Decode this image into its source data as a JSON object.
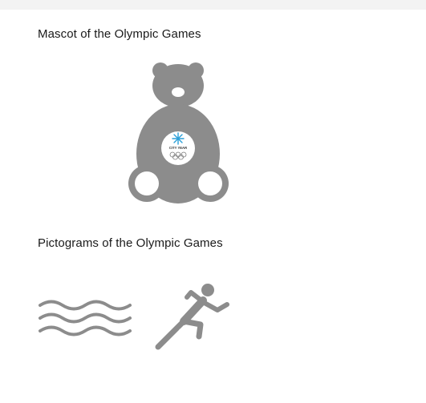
{
  "sections": {
    "mascot": {
      "title": "Mascot of the Olympic Games",
      "badge_text": "CITY YEAR",
      "icon": "teddy-bear-icon"
    },
    "pictograms": {
      "title": "Pictograms of the Olympic Games",
      "items": [
        {
          "icon": "swimming-waves-icon"
        },
        {
          "icon": "running-athlete-icon"
        }
      ]
    }
  },
  "colors": {
    "pictogram_gray": "#8c8c8c",
    "snowflake_blue": "#2a9fd8",
    "ring_gray": "#7a7a7a",
    "topbar_bg": "#f3f3f3"
  }
}
